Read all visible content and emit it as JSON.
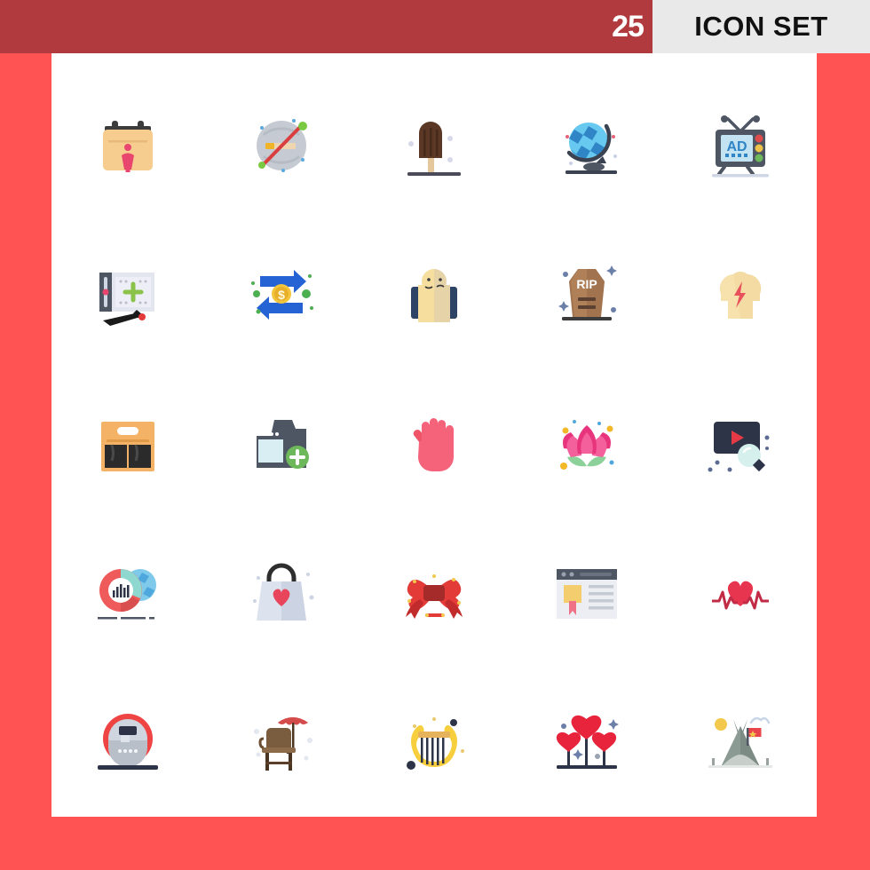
{
  "header": {
    "count": "25",
    "title": "ICON SET",
    "bar_color": "#b03a3d",
    "panel_color": "#e9e9e9",
    "count_text_color": "#ffffff",
    "title_text_color": "#111111"
  },
  "page": {
    "background_color": "#ff5252",
    "canvas_color": "#ffffff",
    "columns": 5,
    "rows": 5,
    "total_icons": 25
  },
  "icons": [
    {
      "index": 1,
      "name": "calendar-person-icon",
      "label": "Calendar with person",
      "colors": [
        "#f7cd8f",
        "#e8456f",
        "#3c3c3c"
      ]
    },
    {
      "index": 2,
      "name": "no-smoking-icon",
      "label": "No smoking",
      "colors": [
        "#c6cbd3",
        "#d93f3f",
        "#f0b429",
        "#7ac943"
      ]
    },
    {
      "index": 3,
      "name": "popsicle-icon",
      "label": "Chocolate popsicle",
      "colors": [
        "#5a3825",
        "#e4c79a",
        "#4a4a58"
      ]
    },
    {
      "index": 4,
      "name": "globe-stand-icon",
      "label": "Desk globe",
      "colors": [
        "#67c9ef",
        "#2f85c6",
        "#3b4251"
      ]
    },
    {
      "index": 5,
      "name": "tv-ad-icon",
      "label": "Television advertisement",
      "text": "AD",
      "colors": [
        "#4f5663",
        "#c3e3f2",
        "#dd4b4b",
        "#edc14a",
        "#6eb85c"
      ]
    },
    {
      "index": 6,
      "name": "drawing-tablet-icon",
      "label": "Graphics tablet and stylus",
      "colors": [
        "#4f5663",
        "#e3e5ef",
        "#8bc34a",
        "#e8456f",
        "#1a1a1a"
      ]
    },
    {
      "index": 7,
      "name": "money-exchange-icon",
      "label": "Money transfer arrows",
      "text": "$",
      "colors": [
        "#2563d4",
        "#f2c53d",
        "#4caf50"
      ]
    },
    {
      "index": 8,
      "name": "bipolar-faces-icon",
      "label": "Dual personality faces",
      "colors": [
        "#f5de9e",
        "#e7d3a8",
        "#2e4466"
      ]
    },
    {
      "index": 9,
      "name": "coffin-rip-icon",
      "label": "Coffin tombstone",
      "text": "RIP",
      "colors": [
        "#a1734f",
        "#5c4032",
        "#3c3c3c"
      ]
    },
    {
      "index": 10,
      "name": "head-lightning-icon",
      "label": "Head with lightning bolt",
      "colors": [
        "#f7e2ae",
        "#e8505b"
      ]
    },
    {
      "index": 11,
      "name": "beer-pack-icon",
      "label": "Beer bottle pack",
      "colors": [
        "#f4b266",
        "#2b2b2b",
        "#ffffff"
      ]
    },
    {
      "index": 12,
      "name": "add-photo-icon",
      "label": "Camera add photo",
      "colors": [
        "#4f5663",
        "#d9eef2",
        "#6eb85c"
      ]
    },
    {
      "index": 13,
      "name": "hand-palm-icon",
      "label": "Open hand palm",
      "colors": [
        "#f4637a",
        "#ef5566"
      ]
    },
    {
      "index": 14,
      "name": "lotus-flower-icon",
      "label": "Lotus flower",
      "colors": [
        "#e8337d",
        "#f4609c",
        "#8dd19a",
        "#f2b828"
      ]
    },
    {
      "index": 15,
      "name": "video-search-icon",
      "label": "Video search",
      "colors": [
        "#2e3448",
        "#e63946",
        "#d6f0ee"
      ]
    },
    {
      "index": 16,
      "name": "global-analytics-icon",
      "label": "Global analytics chart",
      "colors": [
        "#ef5a5a",
        "#8fd8cf",
        "#4fa8dd",
        "#2e3448"
      ]
    },
    {
      "index": 17,
      "name": "shopping-bag-heart-icon",
      "label": "Shopping bag with heart",
      "colors": [
        "#dde3ee",
        "#2e2e2e",
        "#e8455c"
      ]
    },
    {
      "index": 18,
      "name": "ribbon-bow-icon",
      "label": "Red ribbon bow",
      "colors": [
        "#e23b38",
        "#a52a2a",
        "#f2c94c"
      ]
    },
    {
      "index": 19,
      "name": "web-certificate-icon",
      "label": "Web page certificate",
      "colors": [
        "#4f5663",
        "#e9e9ee",
        "#f4ce6e",
        "#ef7286"
      ]
    },
    {
      "index": 20,
      "name": "heartbeat-icon",
      "label": "Heartbeat pulse",
      "colors": [
        "#e8354f",
        "#c22b45"
      ]
    },
    {
      "index": 21,
      "name": "round-monitor-icon",
      "label": "Round display device",
      "colors": [
        "#ef4444",
        "#b9bfc9",
        "#2e3448"
      ]
    },
    {
      "index": 22,
      "name": "beach-chair-umbrella-icon",
      "label": "Chair with parasol",
      "colors": [
        "#7a5c3e",
        "#4a3522",
        "#e05a5a"
      ]
    },
    {
      "index": 23,
      "name": "lyre-harp-icon",
      "label": "Golden lyre harp",
      "colors": [
        "#f7cf3e",
        "#e6b35c",
        "#2e3448"
      ]
    },
    {
      "index": 24,
      "name": "heart-balloons-icon",
      "label": "Heart balloons",
      "colors": [
        "#e8243c",
        "#2e3448"
      ]
    },
    {
      "index": 25,
      "name": "camping-tent-icon",
      "label": "Camping tent with flag",
      "colors": [
        "#8b9b93",
        "#c8cfcb",
        "#e8454c",
        "#f2c94c"
      ]
    }
  ]
}
